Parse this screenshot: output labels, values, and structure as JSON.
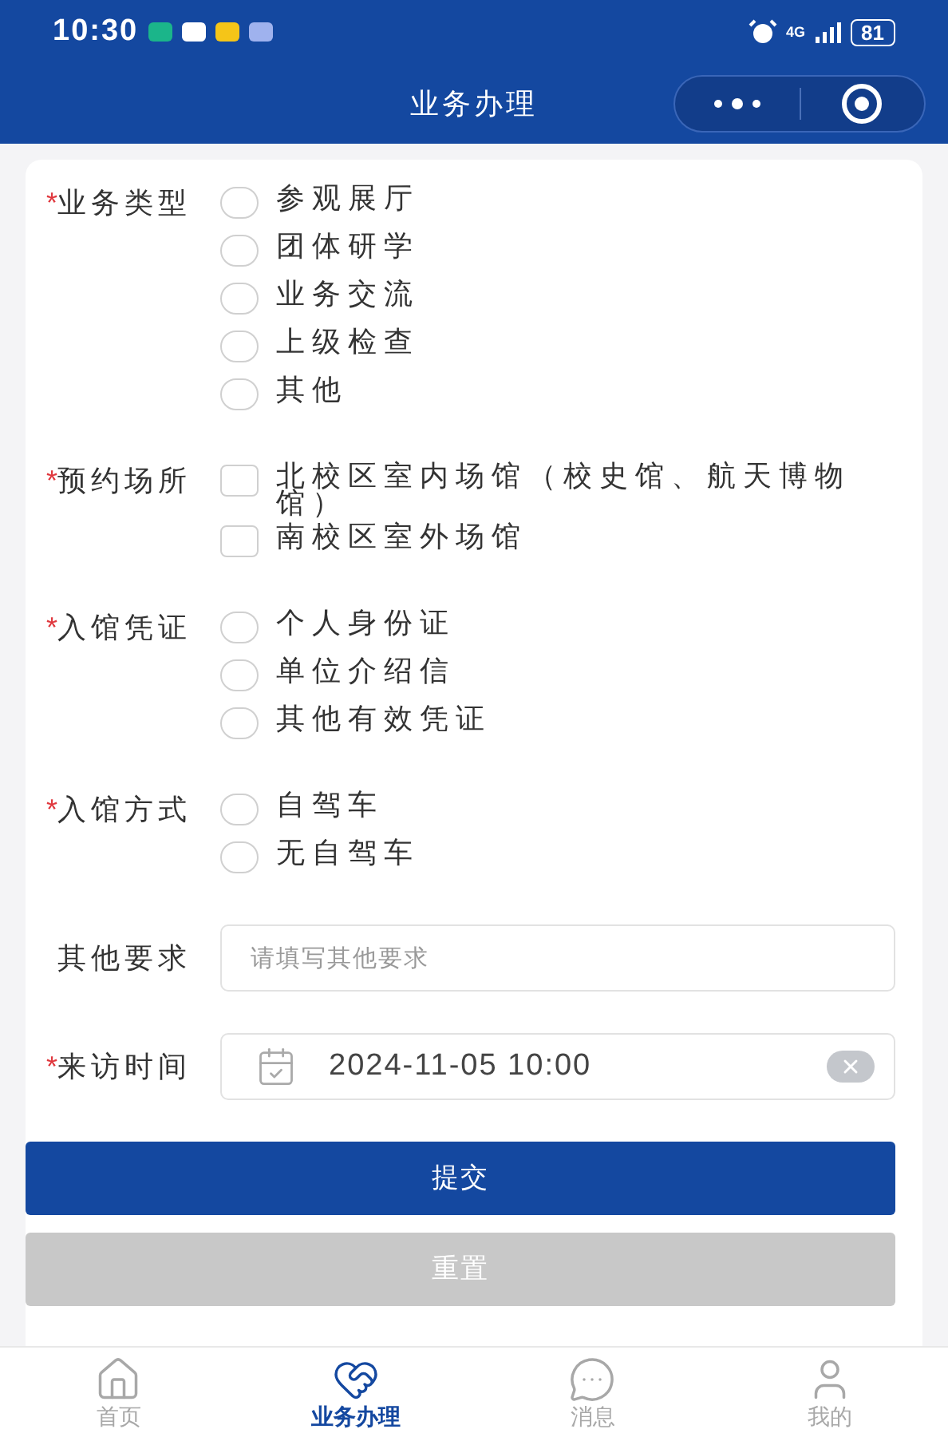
{
  "status_bar": {
    "time": "10:30",
    "network": "4G",
    "battery": "81"
  },
  "header": {
    "title": "业务办理"
  },
  "groups": [
    {
      "kind": "radio",
      "label": "业务类型",
      "required_mark": "*",
      "options": [
        {
          "label": "参观展厅",
          "selected": false
        },
        {
          "label": "团体研学",
          "selected": false
        },
        {
          "label": "业务交流",
          "selected": false
        },
        {
          "label": "上级检查",
          "selected": false
        },
        {
          "label": "其他",
          "selected": false
        }
      ]
    },
    {
      "kind": "checkbox",
      "label": "预约场所",
      "required_mark": "*",
      "options": [
        {
          "label": "北校区室内场馆（校史馆、航天博物馆）",
          "checked": false
        },
        {
          "label": "南校区室外场馆",
          "checked": false
        }
      ]
    },
    {
      "kind": "radio",
      "label": "入馆凭证",
      "required_mark": "*",
      "options": [
        {
          "label": "个人身份证",
          "selected": false
        },
        {
          "label": "单位介绍信",
          "selected": false
        },
        {
          "label": "其他有效凭证",
          "selected": false
        }
      ]
    },
    {
      "kind": "radio",
      "label": "入馆方式",
      "required_mark": "*",
      "options": [
        {
          "label": "自驾车",
          "selected": false
        },
        {
          "label": "无自驾车",
          "selected": false
        }
      ]
    }
  ],
  "other_requirements": {
    "label": "其他要求",
    "placeholder": "请填写其他要求"
  },
  "visit_time": {
    "label": "来访时间",
    "required_mark": "*",
    "value": "2024-11-05 10:00"
  },
  "buttons": [
    {
      "label": "提交",
      "disabled": false
    },
    {
      "label": "重置",
      "disabled": true
    }
  ],
  "tabs": [
    {
      "label": "首页",
      "selected": false
    },
    {
      "label": "业务办理",
      "selected": true
    },
    {
      "label": "消息",
      "selected": false
    },
    {
      "label": "我的",
      "selected": false
    }
  ]
}
